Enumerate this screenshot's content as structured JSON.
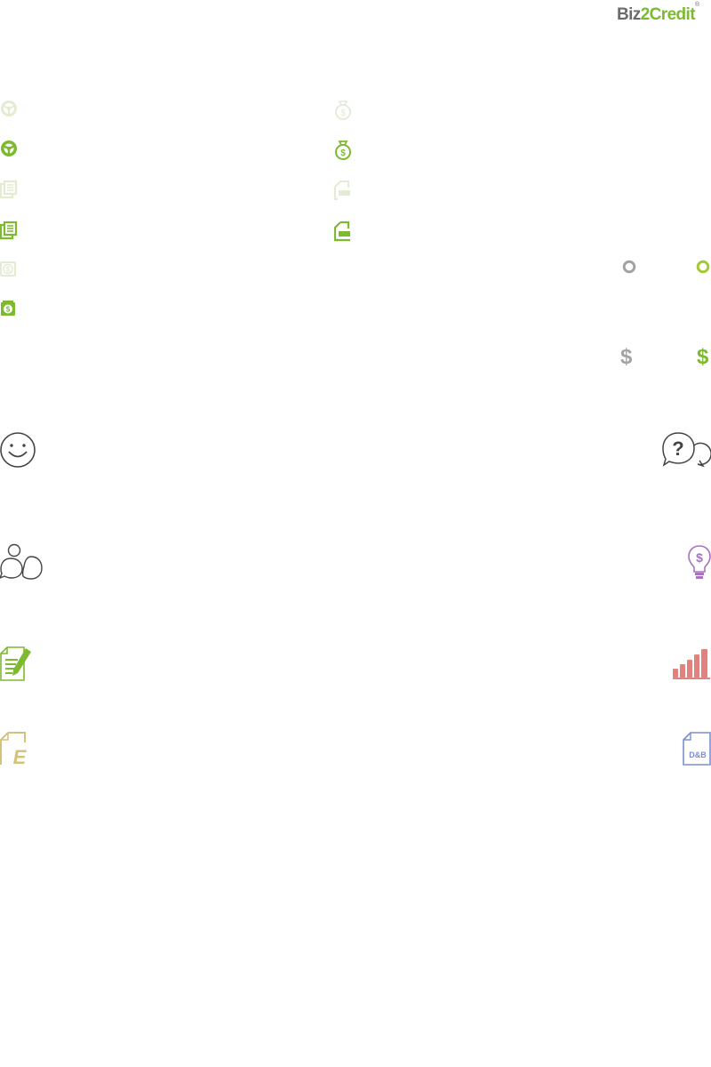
{
  "logo": {
    "part1": "Biz",
    "part2": "2",
    "part3": "Credit",
    "reg": "®"
  },
  "colors": {
    "green": "#7dba2f",
    "green_light": "#e3ecd3",
    "grey": "#a3a3a3",
    "dark_outline": "#444444",
    "purple": "#a872bf",
    "red": "#e2817e",
    "tan": "#d5c27a",
    "blue": "#7a8fcf",
    "lime": "#a4c936"
  },
  "sprites": {
    "small_icons": [
      {
        "name": "steering-wheel-icon",
        "state": "inactive"
      },
      {
        "name": "steering-wheel-icon",
        "state": "active"
      },
      {
        "name": "documents-icon",
        "state": "inactive"
      },
      {
        "name": "documents-icon",
        "state": "active"
      },
      {
        "name": "cash-icon",
        "state": "inactive"
      },
      {
        "name": "cash-icon",
        "state": "active"
      },
      {
        "name": "money-bag-icon",
        "state": "inactive"
      },
      {
        "name": "money-bag-icon",
        "state": "active"
      },
      {
        "name": "file-form-icon",
        "state": "inactive"
      },
      {
        "name": "file-form-icon",
        "state": "active"
      },
      {
        "name": "circle-icon",
        "state": "inactive"
      },
      {
        "name": "circle-icon",
        "state": "active"
      }
    ],
    "dollar_symbol": "$",
    "large_icons": [
      "smiley-icon",
      "question-chat-icon",
      "chat-bubbles-icon",
      "lightbulb-dollar-icon",
      "document-pencil-icon",
      "bar-chart-icon",
      "e-file-icon",
      "dnb-file-icon"
    ],
    "dnb_label": "D&B",
    "e_label": "E",
    "question_label": "?"
  }
}
